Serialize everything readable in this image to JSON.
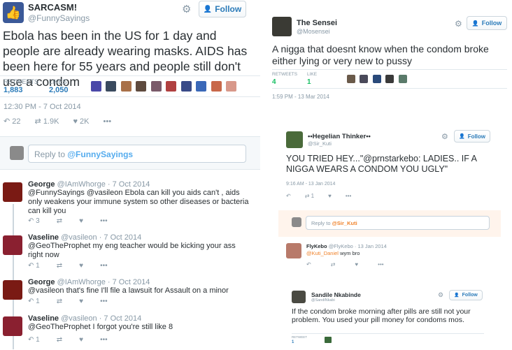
{
  "left": {
    "author": {
      "name": "SARCASM!",
      "handle": "@FunnySayings"
    },
    "follow_label": "Follow",
    "text": "Ebola has been in the US for 1 day and people are already wearing masks. AIDS has been here for 55 years and people still don't use a condom",
    "stats": {
      "retweets_label": "RETWEETS",
      "retweets": "1,883",
      "likes_label": "LIKES",
      "likes": "2,050"
    },
    "timestamp": "12:30 PM - 7 Oct 2014",
    "actions": {
      "replies": "22",
      "retweets": "1.9K",
      "likes": "2K"
    },
    "reply_prefix": "Reply to ",
    "reply_handle": "@FunnySayings",
    "replies": [
      {
        "name": "George",
        "handle": "@IAmWhorge",
        "date": "· 7 Oct 2014",
        "text": "@FunnySayings @vasileon Ebola can kill you aids can't , aids only weakens your immune system so other diseases or bacteria can kill you",
        "reply_count": "3",
        "avatar": "#7a1a14"
      },
      {
        "name": "Vaseline",
        "handle": "@vasileon",
        "date": "· 7 Oct 2014",
        "text": "@GeoTheProphet my eng teacher would be kicking your ass right now",
        "reply_count": "1",
        "avatar": "#8a2030"
      },
      {
        "name": "George",
        "handle": "@IAmWhorge",
        "date": "· 7 Oct 2014",
        "text": "@vasileon that's fine I'll file a lawsuit for Assault on a minor",
        "reply_count": "1",
        "avatar": "#7a1a14"
      },
      {
        "name": "Vaseline",
        "handle": "@vasileon",
        "date": "· 7 Oct 2014",
        "text": "@GeoTheProphet I forgot you're still like 8",
        "reply_count": "1",
        "avatar": "#8a2030"
      }
    ]
  },
  "sensei": {
    "author": {
      "name": "The Sensei",
      "handle": "@Mosensei"
    },
    "follow_label": "Follow",
    "text": "A nigga that doesnt know when the condom broke either lying or very new to pussy",
    "stats": {
      "retweets_label": "RETWEETS",
      "retweets": "4",
      "likes_label": "LIKE",
      "likes": "1"
    },
    "timestamp": "1:59 PM - 13 Mar 2014"
  },
  "hegelian": {
    "author": {
      "name": "••Hegelian Thinker••",
      "handle": "@Sir_Kuti"
    },
    "follow_label": "Follow",
    "text": "YOU TRIED HEY...\"@prnstarkebo: LADIES.. IF A NIGGA WEARS A CONDOM YOU UGLY\"",
    "timestamp": "9:16 AM - 13 Jan 2014",
    "actions": {
      "retweets": "1"
    },
    "reply_prefix": "Reply to ",
    "reply_handle": "@Sir_Kuti",
    "reply": {
      "name": "FlyKebo",
      "handle": "@FlyKebo",
      "date": "· 13 Jan 2014",
      "mention": "@Kuti_Daniel",
      "text": " wym bro"
    }
  },
  "sandile": {
    "author": {
      "name": "Sandile Nkabinde",
      "handle": "@SandiNkabi"
    },
    "follow_label": "Follow",
    "text": "If the condom broke morning after pills are still not your problem. You used your pill money for condoms mos.",
    "stats": {
      "retweets_label": "RETWEET",
      "retweets": "1"
    }
  },
  "icons": {
    "gear": "gear-icon",
    "follow": "add-user-icon",
    "reply": "reply-icon",
    "retweet": "retweet-icon",
    "like": "heart-icon",
    "more": "more-icon"
  },
  "colors": {
    "link": "#55acee",
    "reply_bg": "#fff4ec",
    "green": "#17bf63"
  }
}
